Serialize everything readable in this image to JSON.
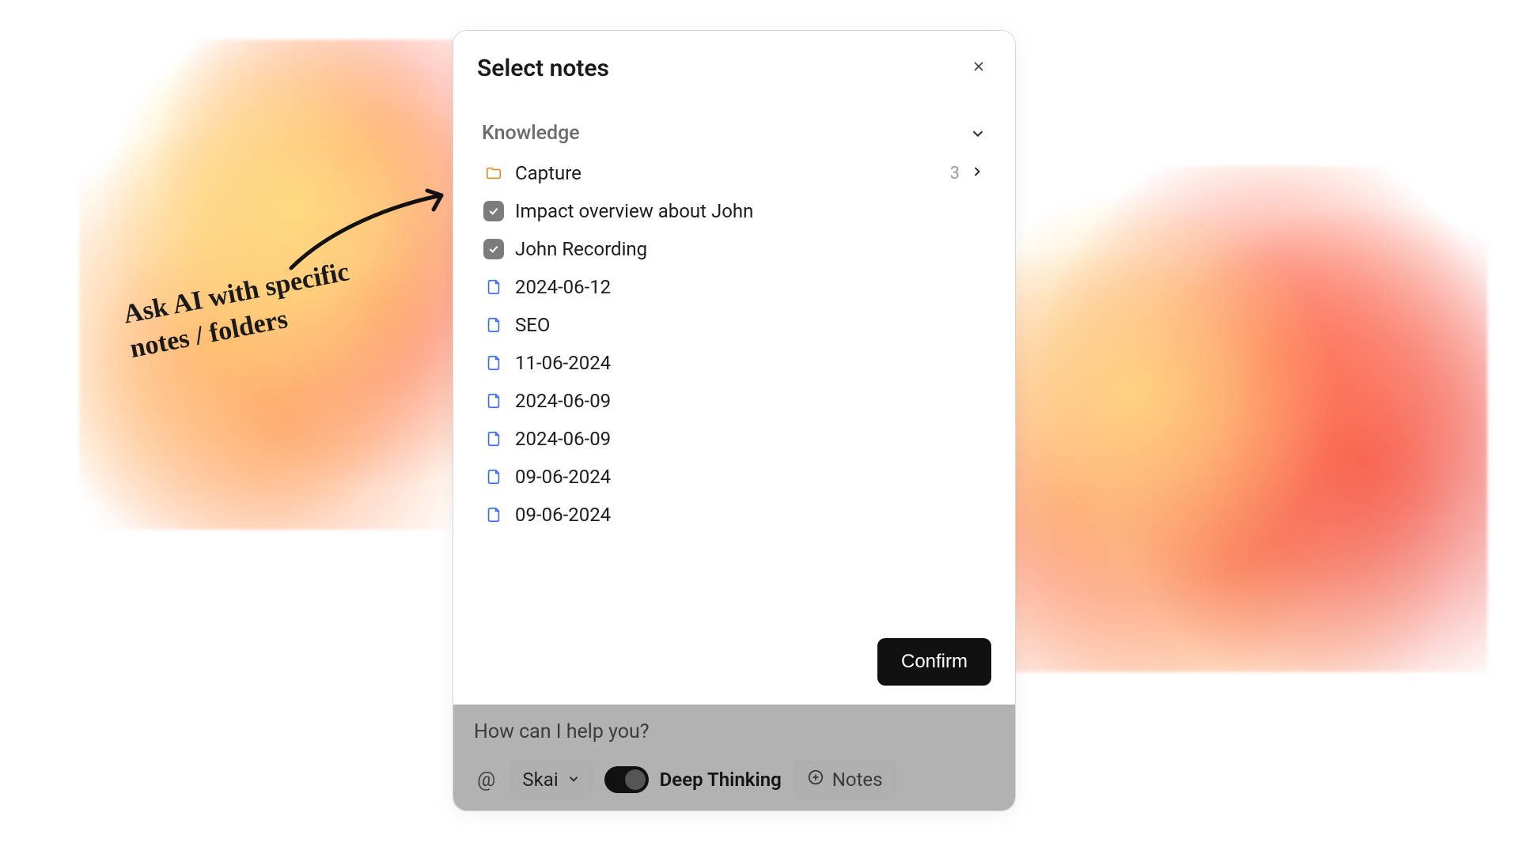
{
  "modal": {
    "title": "Select notes",
    "section_title": "Knowledge",
    "confirm_label": "Confirm",
    "items": [
      {
        "type": "folder",
        "label": "Capture",
        "count": "3"
      },
      {
        "type": "checked",
        "label": "Impact overview about John"
      },
      {
        "type": "checked",
        "label": "John Recording"
      },
      {
        "type": "file",
        "label": "2024-06-12"
      },
      {
        "type": "file",
        "label": "SEO"
      },
      {
        "type": "file",
        "label": "11-06-2024"
      },
      {
        "type": "file",
        "label": "2024-06-09"
      },
      {
        "type": "file",
        "label": "2024-06-09"
      },
      {
        "type": "file",
        "label": "09-06-2024"
      },
      {
        "type": "file",
        "label": "09-06-2024"
      }
    ]
  },
  "ask": {
    "placeholder": "How can I help you?",
    "model": "Skai",
    "deep_thinking_label": "Deep Thinking",
    "notes_label": "Notes"
  },
  "annotation": {
    "line1": "Ask AI with specific",
    "line2": "notes / folders"
  }
}
